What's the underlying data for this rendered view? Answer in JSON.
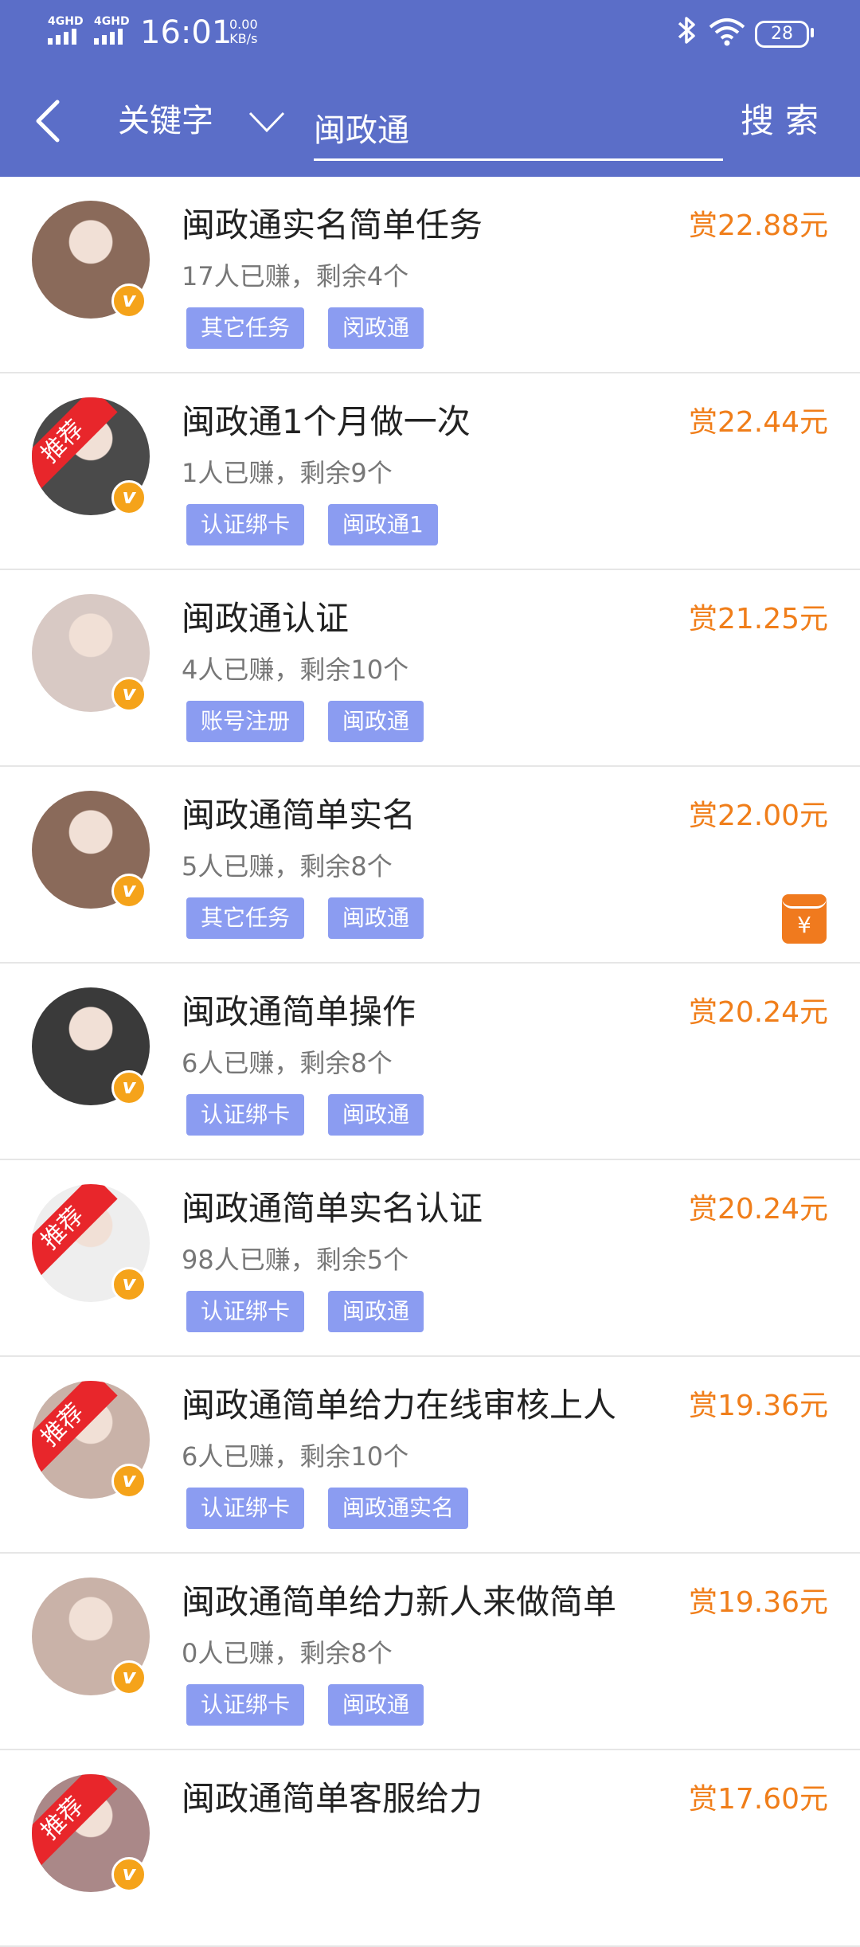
{
  "status_bar": {
    "signal1": "4GHD",
    "signal2": "4GHD",
    "time": "16:01",
    "speed_value": "0.00",
    "speed_unit": "KB/s",
    "battery": "28"
  },
  "header": {
    "search_type": "关键字",
    "search_value": "闽政通",
    "search_button": "搜索"
  },
  "colors": {
    "header_bg": "#5b6ec8",
    "reward": "#f07e1a",
    "tag_bg": "#8b9cf1",
    "ribbon": "#e8262b",
    "badge": "#f5a31a"
  },
  "tasks": [
    {
      "title": "闽政通实名简单任务",
      "reward": "赏22.88元",
      "meta": "17人已赚，剩余4个",
      "tags": [
        "其它任务",
        "闵政通"
      ],
      "recommended": false,
      "avatar_color": "#8a6a5a"
    },
    {
      "title": "闽政通1个月做一次",
      "reward": "赏22.44元",
      "meta": "1人已赚，剩余9个",
      "tags": [
        "认证绑卡",
        "闽政通1"
      ],
      "recommended": true,
      "ribbon_text": "推荐",
      "avatar_color": "#4a4a4a"
    },
    {
      "title": "闽政通认证",
      "reward": "赏21.25元",
      "meta": "4人已赚，剩余10个",
      "tags": [
        "账号注册",
        "闽政通"
      ],
      "recommended": false,
      "avatar_color": "#d8c9c4"
    },
    {
      "title": "闽政通简单实名",
      "reward": "赏22.00元",
      "meta": "5人已赚，剩余8个",
      "tags": [
        "其它任务",
        "闽政通"
      ],
      "recommended": false,
      "avatar_color": "#8a6a5a",
      "red_packet": "¥"
    },
    {
      "title": "闽政通简单操作",
      "reward": "赏20.24元",
      "meta": "6人已赚，剩余8个",
      "tags": [
        "认证绑卡",
        "闽政通"
      ],
      "recommended": false,
      "avatar_color": "#3a3a3a"
    },
    {
      "title": "闽政通简单实名认证",
      "reward": "赏20.24元",
      "meta": "98人已赚，剩余5个",
      "tags": [
        "认证绑卡",
        "闽政通"
      ],
      "recommended": true,
      "ribbon_text": "推荐",
      "avatar_color": "#eeeeee"
    },
    {
      "title": "闽政通简单给力在线审核上人",
      "reward": "赏19.36元",
      "meta": "6人已赚，剩余10个",
      "tags": [
        "认证绑卡",
        "闽政通实名"
      ],
      "recommended": true,
      "ribbon_text": "推荐",
      "avatar_color": "#c9b2a8"
    },
    {
      "title": "闽政通简单给力新人来做简单",
      "reward": "赏19.36元",
      "meta": "0人已赚，剩余8个",
      "tags": [
        "认证绑卡",
        "闽政通"
      ],
      "recommended": false,
      "avatar_color": "#c9b2a8"
    },
    {
      "title": "闽政通简单客服给力",
      "reward": "赏17.60元",
      "meta": "",
      "tags": [],
      "recommended": true,
      "ribbon_text": "推荐",
      "avatar_color": "#a88"
    }
  ]
}
